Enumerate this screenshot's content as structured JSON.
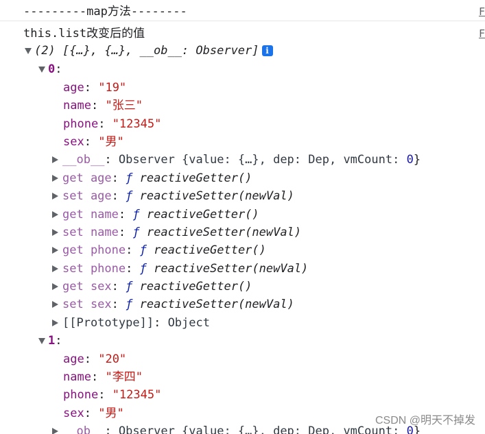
{
  "header_line": "---------map方法--------",
  "header_src": "F",
  "list_label": "this.list改变后的值",
  "list_src": "F",
  "array_summary": {
    "prefix": "(2) [{…}, {…}, __ob__: Observer]"
  },
  "items": [
    {
      "index": "0",
      "age": "\"19\"",
      "name": "\"张三\"",
      "phone": "\"12345\"",
      "sex": "\"男\""
    },
    {
      "index": "1",
      "age": "\"20\"",
      "name": "\"李四\"",
      "phone": "\"12345\"",
      "sex": "\"男\""
    }
  ],
  "labels": {
    "age": "age",
    "name": "name",
    "phone": "phone",
    "sex": "sex",
    "colon": ":",
    "ob": "__ob__",
    "observer_text": "Observer {value: {…}, dep: Dep, vmCount: ",
    "vmcount_value": "0",
    "close_brace": "}",
    "get_age": "get age",
    "set_age": "set age",
    "get_name": "get name",
    "set_name": "set name",
    "get_phone": "get phone",
    "set_phone": "set phone",
    "get_sex": "get sex",
    "set_sex": "set sex",
    "f": "ƒ",
    "getter": "reactiveGetter()",
    "setter": "reactiveSetter(newVal)",
    "prototype": "[[Prototype]]",
    "object": "Object"
  },
  "watermark": "CSDN @明天不掉发",
  "icons": {
    "info": "info-icon",
    "expand": "triangle-down-icon",
    "collapse": "triangle-right-icon"
  }
}
